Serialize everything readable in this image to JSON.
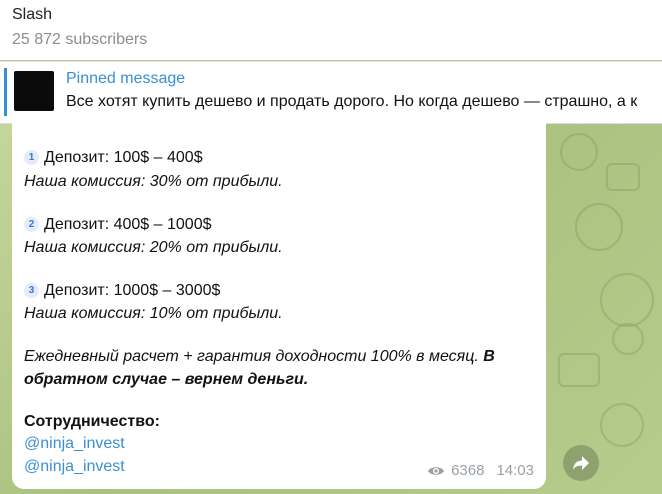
{
  "header": {
    "title": "Slash",
    "subscribers": "25 872 subscribers"
  },
  "pinned": {
    "label": "Pinned message",
    "text": "Все хотят купить дешево и продать дорого. Но когда дешево — страшно, а к"
  },
  "message": {
    "tiers": [
      {
        "num": "1",
        "deposit": "Депозит: 100$ – 400$",
        "fee": "Наша комиссия: 30% от прибыли."
      },
      {
        "num": "2",
        "deposit": "Депозит: 400$ – 1000$",
        "fee": "Наша комиссия: 20% от прибыли."
      },
      {
        "num": "3",
        "deposit": "Депозит: 1000$ – 3000$",
        "fee": "Наша комиссия: 10% от прибыли."
      }
    ],
    "guarantee_italic": "Ежедневный расчет + гарантия доходности 100% в месяц. ",
    "guarantee_bold_1": "В",
    "guarantee_bold_2": "обратном случае – вернем деньги.",
    "coop_label": "Сотрудничество:",
    "contacts": [
      "@ninja_invest",
      "@ninja_invest"
    ],
    "views": "6368",
    "time": "14:03"
  },
  "icons": {
    "views": "eye-icon",
    "forward": "forward-arrow-icon"
  },
  "colors": {
    "accent": "#3a8fd3",
    "chat_background": "#b5c98c"
  }
}
